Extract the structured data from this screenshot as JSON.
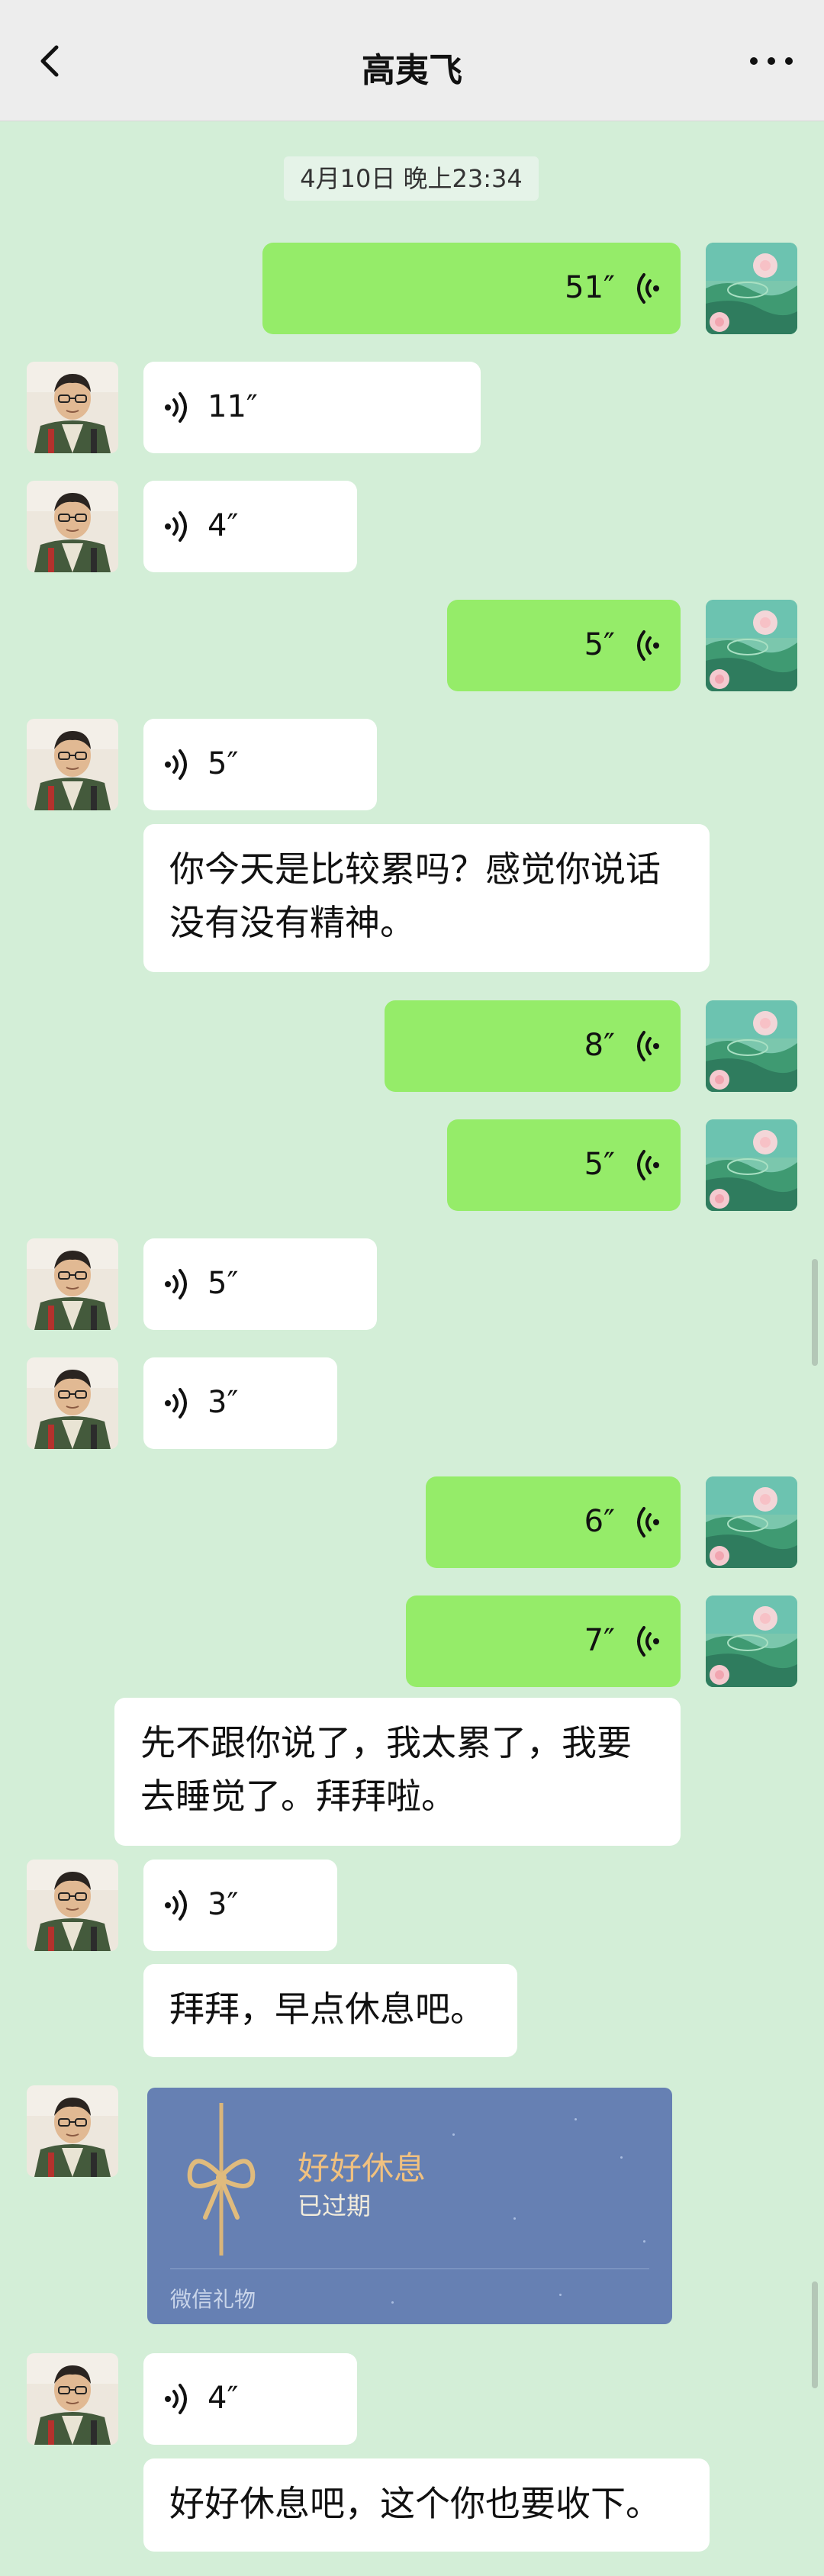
{
  "header": {
    "title": "高夷飞"
  },
  "timestamp": "4月10日 晚上23:34",
  "messages": [
    {
      "duration": "51″"
    },
    {
      "duration": "11″"
    },
    {
      "duration": "4″"
    },
    {
      "duration": "5″"
    },
    {
      "duration": "5″"
    },
    {
      "text": "你今天是比较累吗？感觉你说话没有没有精神。"
    },
    {
      "duration": "8″"
    },
    {
      "duration": "5″"
    },
    {
      "duration": "5″"
    },
    {
      "duration": "3″"
    },
    {
      "duration": "6″"
    },
    {
      "duration": "7″"
    },
    {
      "text": "先不跟你说了，我太累了，我要去睡觉了。拜拜啦。"
    },
    {
      "duration": "3″"
    },
    {
      "text": "拜拜，早点休息吧。"
    },
    {
      "duration": "4″"
    },
    {
      "text": "好好休息吧，这个你也要收下。"
    }
  ],
  "gift": {
    "title": "好好休息",
    "status": "已过期",
    "footer": "微信礼物"
  },
  "colors": {
    "chat_bg": "#d3eed7",
    "outgoing_bubble": "#95ec69",
    "incoming_bubble": "#ffffff",
    "gift_card": "#6680b3"
  }
}
